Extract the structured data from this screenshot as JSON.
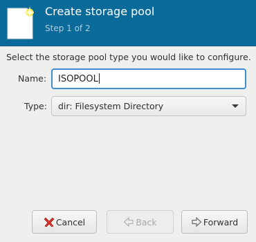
{
  "header": {
    "title": "Create storage pool",
    "subtitle": "Step 1 of 2",
    "icon": "new-document-icon",
    "background_color": "#0a6a9a"
  },
  "main": {
    "instruction": "Select the storage pool type you would like to configure.",
    "name_label": "Name:",
    "name_value": "ISOPOOL",
    "type_label": "Type:",
    "type_value": "dir: Filesystem Directory"
  },
  "buttons": {
    "cancel_label": "Cancel",
    "back_label": "Back",
    "forward_label": "Forward"
  },
  "colors": {
    "focus_border": "#3d8ed4",
    "cancel_icon": "#d9302b"
  }
}
